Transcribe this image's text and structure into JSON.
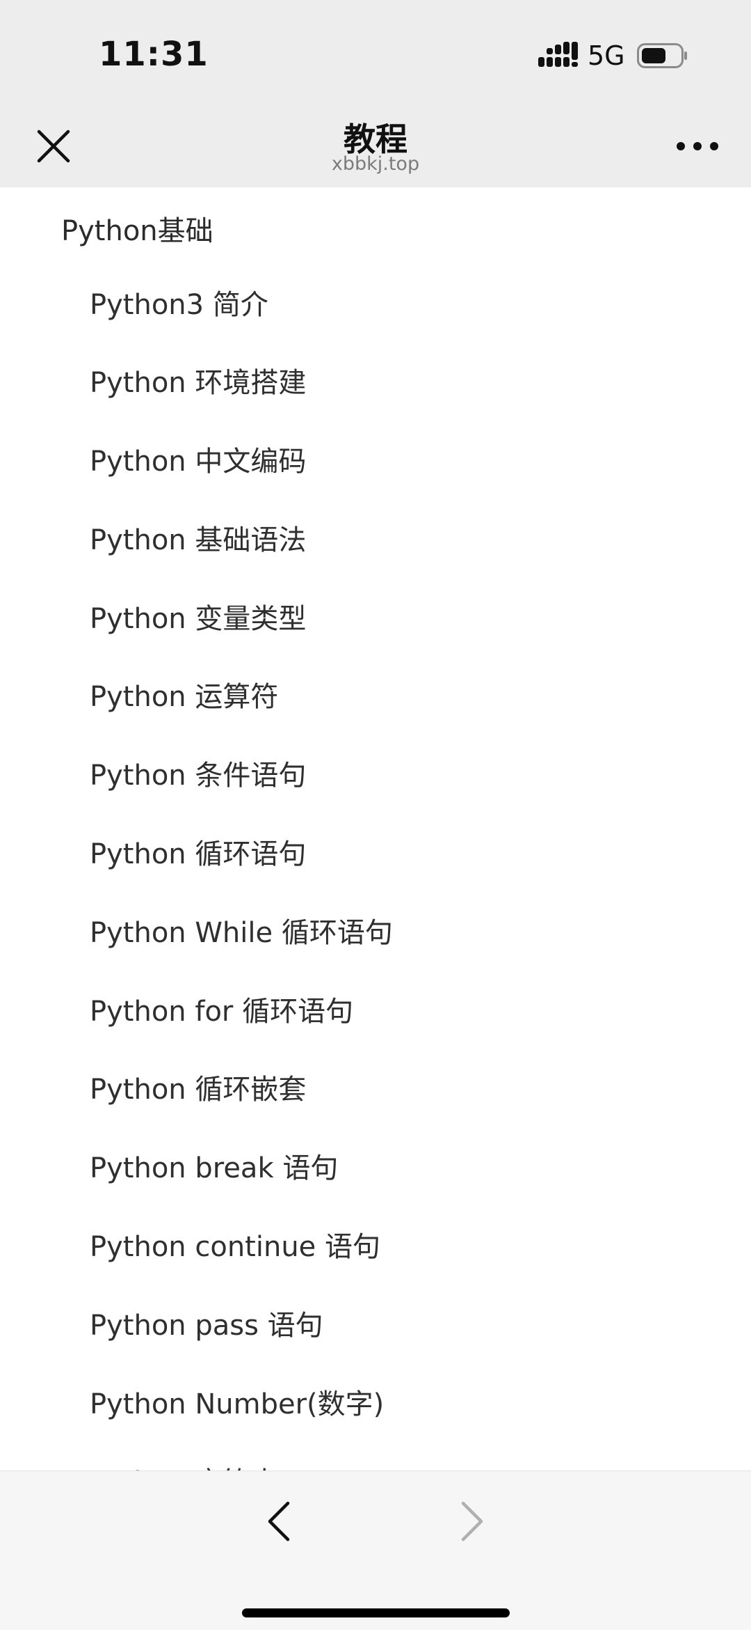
{
  "status_bar": {
    "time": "11:31",
    "network": "5G",
    "signal_icon": "signal-bars-icon",
    "battery_icon": "battery-icon"
  },
  "title_bar": {
    "title": "教程",
    "subtitle": "xbbkj.top",
    "close_icon": "close-icon",
    "more_icon": "more-icon"
  },
  "content": {
    "section_heading": "Python基础",
    "items": [
      "Python3 简介",
      "Python 环境搭建",
      "Python 中文编码",
      "Python 基础语法",
      "Python 变量类型",
      "Python 运算符",
      "Python 条件语句",
      "Python 循环语句",
      "Python While 循环语句",
      "Python for 循环语句",
      "Python 循环嵌套",
      "Python break 语句",
      "Python continue 语句",
      "Python pass 语句",
      "Python Number(数字)",
      "Python 字符串"
    ]
  },
  "bottom_bar": {
    "back_icon": "chevron-left-icon",
    "forward_icon": "chevron-right-icon",
    "forward_enabled": false
  },
  "colors": {
    "bar_background": "#ededed",
    "content_background": "#ffffff",
    "text": "#2f2f2f",
    "subtitle": "#7b7b7b",
    "disabled_icon": "#b0b0b0"
  }
}
